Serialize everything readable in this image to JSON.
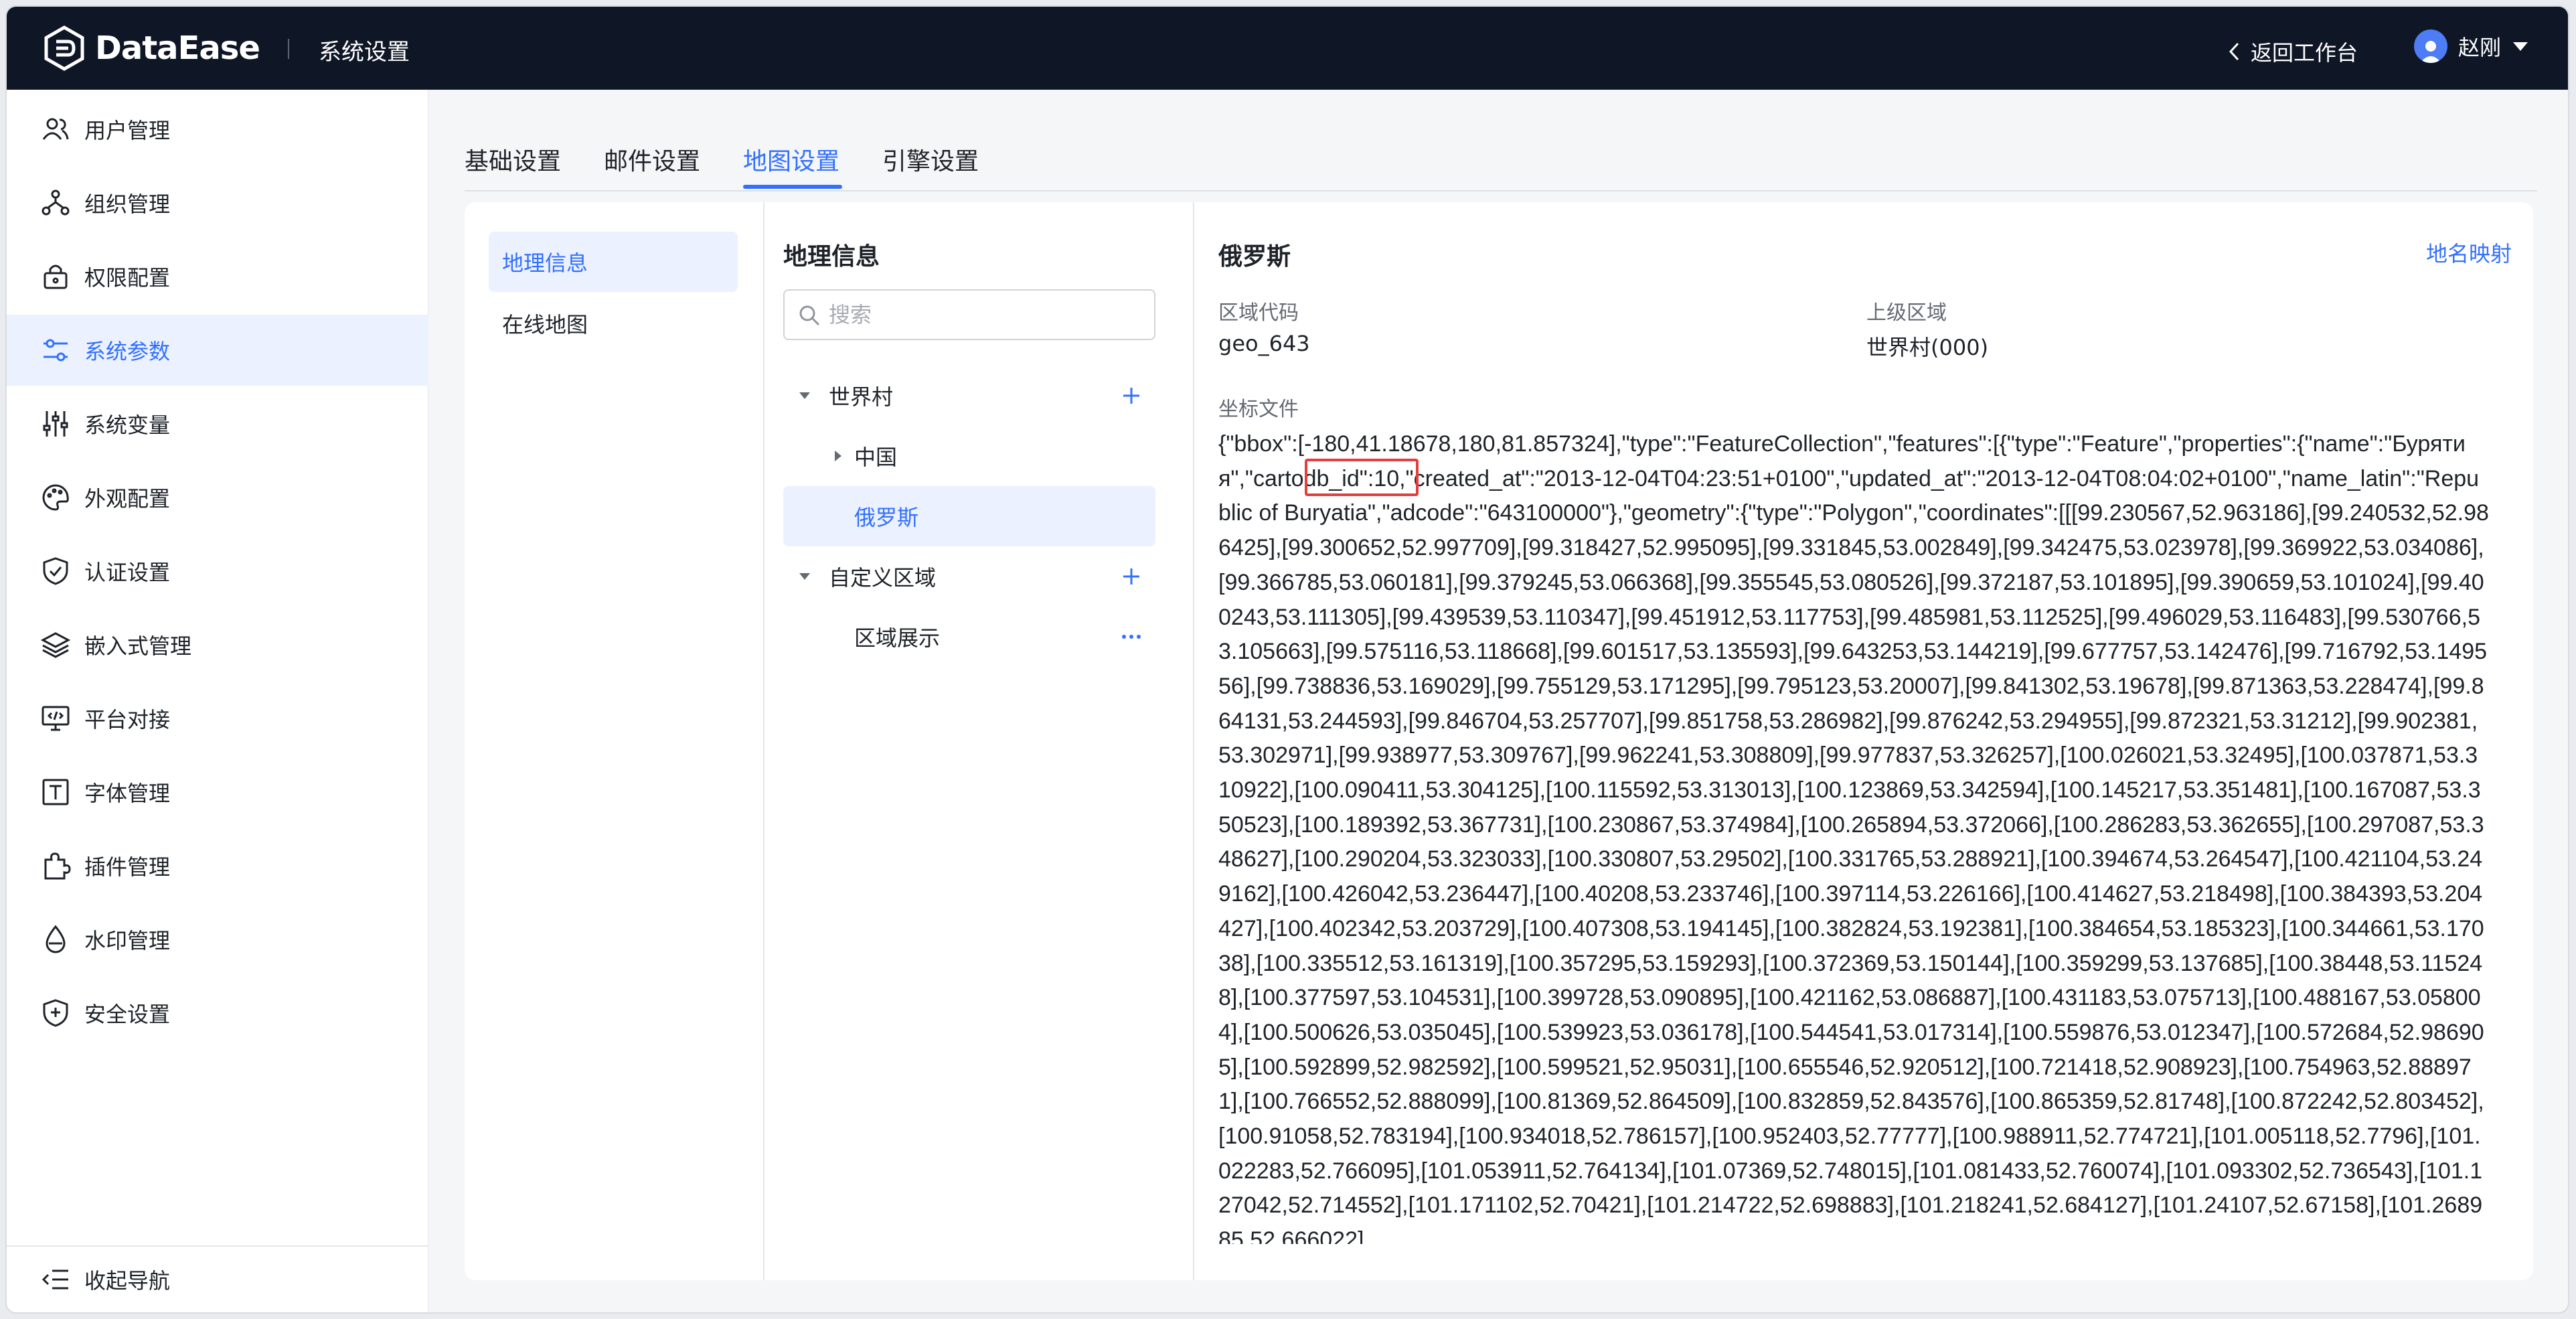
{
  "header": {
    "app_name": "DataEase",
    "section_title": "系统设置",
    "back_label": "返回工作台",
    "user_name": "赵刚"
  },
  "sidebar": {
    "items": [
      {
        "label": "用户管理",
        "icon": "users-icon"
      },
      {
        "label": "组织管理",
        "icon": "org-tree-icon"
      },
      {
        "label": "权限配置",
        "icon": "lock-icon"
      },
      {
        "label": "系统参数",
        "icon": "sliders-icon",
        "active": true
      },
      {
        "label": "系统变量",
        "icon": "variables-icon"
      },
      {
        "label": "外观配置",
        "icon": "palette-icon"
      },
      {
        "label": "认证设置",
        "icon": "shield-check-icon"
      },
      {
        "label": "嵌入式管理",
        "icon": "layers-icon"
      },
      {
        "label": "平台对接",
        "icon": "monitor-code-icon"
      },
      {
        "label": "字体管理",
        "icon": "font-icon"
      },
      {
        "label": "插件管理",
        "icon": "puzzle-icon"
      },
      {
        "label": "水印管理",
        "icon": "droplet-icon"
      },
      {
        "label": "安全设置",
        "icon": "security-icon"
      }
    ],
    "collapse_label": "收起导航"
  },
  "tabs": [
    {
      "label": "基础设置"
    },
    {
      "label": "邮件设置"
    },
    {
      "label": "地图设置",
      "active": true
    },
    {
      "label": "引擎设置"
    }
  ],
  "left_nav": {
    "items": [
      {
        "label": "地理信息",
        "active": true
      },
      {
        "label": "在线地图"
      }
    ]
  },
  "tree": {
    "title": "地理信息",
    "search_placeholder": "搜索",
    "nodes": [
      {
        "label": "世界村"
      },
      {
        "label": "中国"
      },
      {
        "label": "俄罗斯",
        "selected": true
      },
      {
        "label": "自定义区域"
      },
      {
        "label": "区域展示"
      }
    ]
  },
  "detail": {
    "title": "俄罗斯",
    "mapping_link": "地名映射",
    "region_code_label": "区域代码",
    "region_code_value": "geo_643",
    "parent_region_label": "上级区域",
    "parent_region_value": "世界村(000)",
    "coord_file_label": "坐标文件",
    "coord_file_content": "{\"bbox\":[-180,41.18678,180,81.857324],\"type\":\"FeatureCollection\",\"features\":[{\"type\":\"Feature\",\"properties\":{\"name\":\"Бурятия\",\"cartodb_id\":10,\"created_at\":\"2013-12-04T04:23:51+0100\",\"updated_at\":\"2013-12-04T08:04:02+0100\",\"name_latin\":\"Republic of Buryatia\",\"adcode\":\"643100000\"},\"geometry\":{\"type\":\"Polygon\",\"coordinates\":[[[99.230567,52.963186],[99.240532,52.986425],[99.300652,52.997709],[99.318427,52.995095],[99.331845,53.002849],[99.342475,53.023978],[99.369922,53.034086],[99.366785,53.060181],[99.379245,53.066368],[99.355545,53.080526],[99.372187,53.101895],[99.390659,53.101024],[99.400243,53.111305],[99.439539,53.110347],[99.451912,53.117753],[99.485981,53.112525],[99.496029,53.116483],[99.530766,53.105663],[99.575116,53.118668],[99.601517,53.135593],[99.643253,53.144219],[99.677757,53.142476],[99.716792,53.149556],[99.738836,53.169029],[99.755129,53.171295],[99.795123,53.20007],[99.841302,53.19678],[99.871363,53.228474],[99.864131,53.244593],[99.846704,53.257707],[99.851758,53.286982],[99.876242,53.294955],[99.872321,53.31212],[99.902381,53.302971],[99.938977,53.309767],[99.962241,53.308809],[99.977837,53.326257],[100.026021,53.32495],[100.037871,53.310922],[100.090411,53.304125],[100.115592,53.313013],[100.123869,53.342594],[100.145217,53.351481],[100.167087,53.350523],[100.189392,53.367731],[100.230867,53.374984],[100.265894,53.372066],[100.286283,53.362655],[100.297087,53.348627],[100.290204,53.323033],[100.330807,53.29502],[100.331765,53.288921],[100.394674,53.264547],[100.421104,53.249162],[100.426042,53.236447],[100.40208,53.233746],[100.397114,53.226166],[100.414627,53.218498],[100.384393,53.204427],[100.402342,53.203729],[100.407308,53.194145],[100.382824,53.192381],[100.384654,53.185323],[100.344661,53.17038],[100.335512,53.161319],[100.357295,53.159293],[100.372369,53.150144],[100.359299,53.137685],[100.38448,53.115248],[100.377597,53.104531],[100.399728,53.090895],[100.421162,53.086887],[100.431183,53.075713],[100.488167,53.058004],[100.500626,53.035045],[100.539923,53.036178],[100.544541,53.017314],[100.559876,53.012347],[100.572684,52.986905],[100.592899,52.982592],[100.599521,52.95031],[100.655546,52.920512],[100.721418,52.908923],[100.754963,52.888971],[100.766552,52.888099],[100.81369,52.864509],[100.832859,52.843576],[100.865359,52.81748],[100.872242,52.803452],[100.91058,52.783194],[100.934018,52.786157],[100.952403,52.77777],[100.988911,52.774721],[101.005118,52.7796],[101.022283,52.766095],[101.053911,52.764134],[101.07369,52.748015],[101.081433,52.760074],[101.093302,52.736543],[101.127042,52.714552],[101.171102,52.70421],[101.214722,52.698883],[101.218241,52.684127],[101.24107,52.67158],[101.268985,52.666022]"
  },
  "colors": {
    "topbar": "#0f1626",
    "accent": "#3370ff",
    "active_bg": "#ebf1ff",
    "highlight_box": "#e53e3e"
  }
}
